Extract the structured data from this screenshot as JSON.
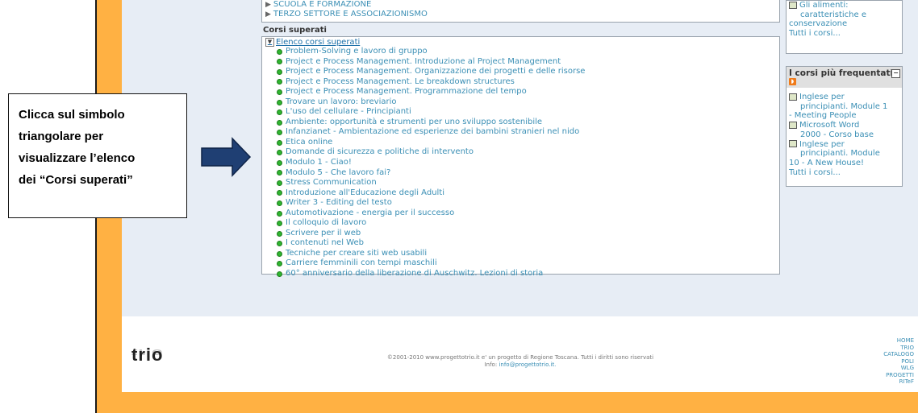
{
  "categories": [
    "SCUOLA E FORMAZIONE",
    "TERZO SETTORE E ASSOCIAZIONISMO"
  ],
  "section_title": "Corsi superati",
  "list_header": "Elenco corsi superati",
  "courses": [
    "Problem-Solving e lavoro di gruppo",
    "Project e Process Management. Introduzione al Project Management",
    "Project e Process Management. Organizzazione dei progetti e delle risorse",
    "Project e Process Management. Le breakdown structures",
    "Project e Process Management. Programmazione del tempo",
    "Trovare un lavoro: breviario",
    "L'uso del cellulare - Principianti",
    "Ambiente: opportunità e strumenti per uno sviluppo sostenibile",
    "Infanzianet - Ambientazione ed esperienze dei bambini stranieri nel nido",
    "Etica online",
    "Domande di sicurezza e politiche di intervento",
    "Modulo 1 - Ciao!",
    "Modulo 5 - Che lavoro fai?",
    "Stress Communication",
    "Introduzione all'Educazione degli Adulti",
    "Writer 3 - Editing del testo",
    "Automotivazione - energia per il successo",
    "Il colloquio di lavoro",
    "Scrivere per il web",
    "I contenuti nel Web",
    "Tecniche per creare siti web usabili",
    "Carriere femminili con tempi maschili",
    "60° anniversario della liberazione di Auschwitz. Lezioni di storia"
  ],
  "sidebar_top": {
    "item_line1": "Gli alimenti:",
    "item_line2": "caratteristiche e",
    "item_line3": "conservazione",
    "all_link": "Tutti i corsi..."
  },
  "sidebar_frequent": {
    "title": "I corsi più frequentati",
    "item1_a": "Inglese per",
    "item1_b": "principianti. Module 1",
    "item1_c": "- Meeting People",
    "item2_a": "Microsoft Word",
    "item2_b": "2000 - Corso base",
    "item3_a": "Inglese per",
    "item3_b": "principianti. Module",
    "item3_c": "10 - A New House!",
    "all_link": "Tutti i corsi..."
  },
  "callout": {
    "line1": "Clicca sul simbolo",
    "line2": "triangolare per",
    "line3": "visualizzare l’elenco",
    "line4": "dei  “Corsi superati”"
  },
  "footer": {
    "logo": "trio",
    "copyright": "©2001-2010 www.progettotrio.it e' un progetto di Regione Toscana. Tutti i diritti sono riservati",
    "info_label": "Info:",
    "info_email": "info@progettotrio.it.",
    "links": [
      "HOME",
      "TRIO",
      "CATALOGO",
      "POLI",
      "WLG",
      "PROGETTI",
      "RITeF"
    ]
  },
  "colors": {
    "frame": "#ffb143",
    "page_bg": "#e7edf5",
    "link": "#3b8fb5",
    "arrow": "#1f3f73",
    "bullet": "#2fb52f"
  }
}
